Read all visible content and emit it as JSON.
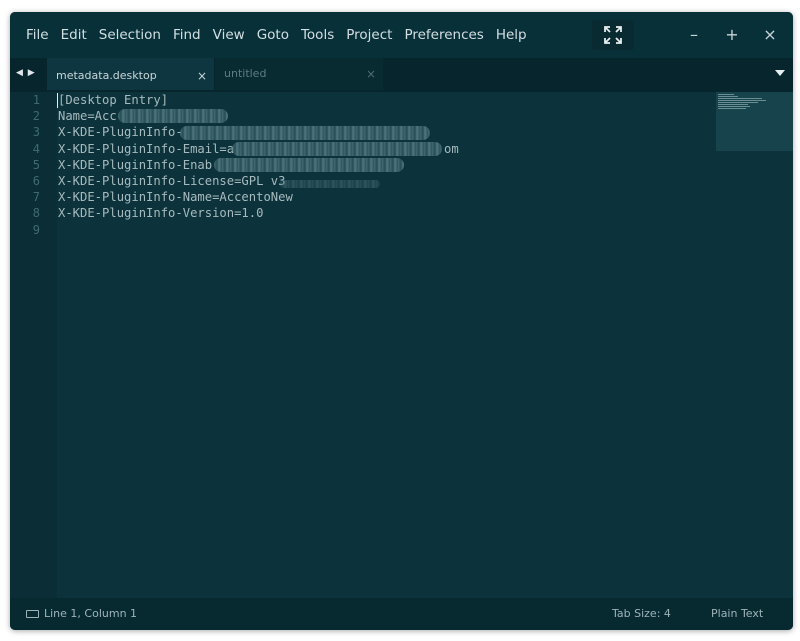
{
  "menu": [
    "File",
    "Edit",
    "Selection",
    "Find",
    "View",
    "Goto",
    "Tools",
    "Project",
    "Preferences",
    "Help"
  ],
  "window_controls": {
    "minimize": "–",
    "maximize": "+",
    "close": "×"
  },
  "tabs": [
    {
      "label": "metadata.desktop",
      "close": "×",
      "active": true
    },
    {
      "label": "untitled",
      "close": "×",
      "active": false
    }
  ],
  "tab_nav": "◀ ▶",
  "editor": {
    "line_numbers": [
      "1",
      "2",
      "3",
      "4",
      "5",
      "6",
      "7",
      "8",
      "9"
    ],
    "lines": [
      "[Desktop Entry]",
      "Name=Acc",
      "X-KDE-PluginInfo-",
      "X-KDE-PluginInfo-Email=a",
      "X-KDE-PluginInfo-Enab",
      "X-KDE-PluginInfo-License=GPL v3",
      "X-KDE-PluginInfo-Name=AccentoNew",
      "X-KDE-PluginInfo-Version=1.0",
      ""
    ],
    "partial_visible_suffixes": {
      "line4": "om"
    }
  },
  "status": {
    "position": "Line 1, Column 1",
    "tab_size": "Tab Size: 4",
    "syntax": "Plain Text"
  },
  "colors": {
    "background": "#0c323b",
    "gutter": "#0b2e36",
    "titlebar": "#073039",
    "text": "#a7babe",
    "line_number": "#3f6a72"
  },
  "icons": [
    "fullscreen-icon",
    "panel-toggle-icon",
    "tab-dropdown-icon",
    "tab-close-icon"
  ]
}
